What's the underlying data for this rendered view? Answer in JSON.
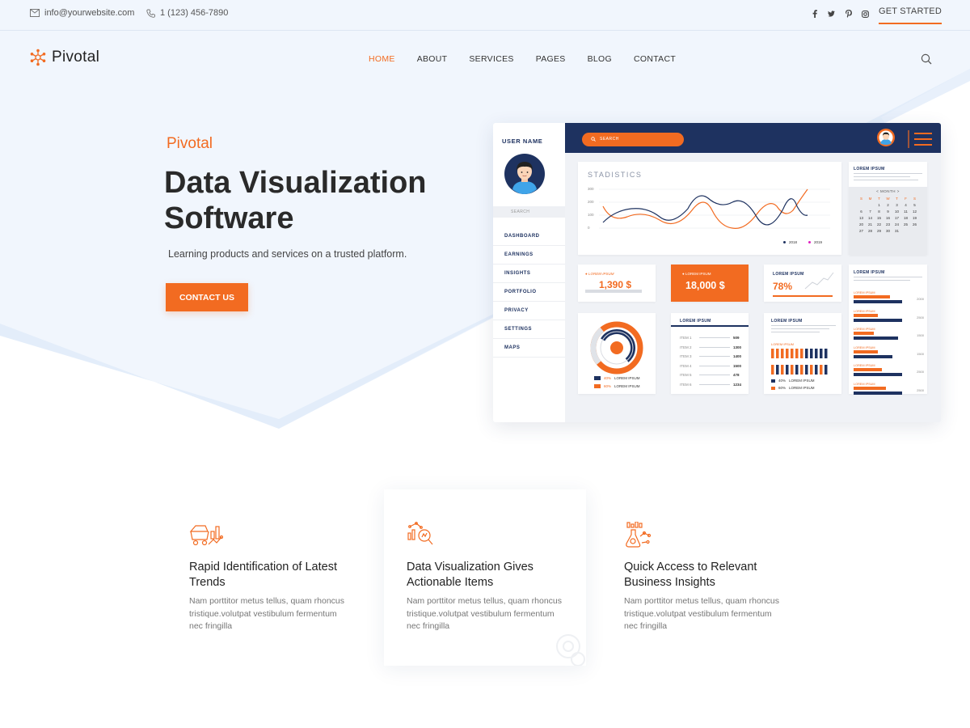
{
  "topbar": {
    "email": "info@yourwebsite.com",
    "phone": "1 (123) 456-7890",
    "social": [
      "facebook-icon",
      "twitter-icon",
      "pinterest-icon",
      "instagram-icon"
    ],
    "cta_label": "GET STARTED"
  },
  "brand": {
    "name": "Pivotal",
    "accent": "#f26b21",
    "navy": "#1e3260"
  },
  "nav": {
    "items": [
      {
        "label": "HOME",
        "active": true
      },
      {
        "label": "ABOUT"
      },
      {
        "label": "SERVICES"
      },
      {
        "label": "PAGES"
      },
      {
        "label": "BLOG"
      },
      {
        "label": "CONTACT"
      }
    ]
  },
  "hero": {
    "eyebrow": "Pivotal",
    "headline_line1": "Data Visualization",
    "headline_line2": "Software",
    "subline": "Learning products and services on a trusted platform.",
    "cta_label": "CONTACT US"
  },
  "dashboard": {
    "user_label": "USER NAME",
    "side_search": "SEARCH",
    "menu": [
      "DASHBOARD",
      "EARNINGS",
      "INSIGHTS",
      "PORTFOLIO",
      "PRIVACY",
      "SETTINGS",
      "MAPS"
    ],
    "top_search": "SEARCH",
    "stats_title": "STADISTICS",
    "stats_legend": [
      "2018",
      "2019"
    ],
    "stats_yticks": [
      "300",
      "200",
      "100",
      "0"
    ],
    "card_label": "LOREM IPSUM",
    "month_label": "MONTH",
    "weekdays": [
      "S",
      "M",
      "T",
      "W",
      "T",
      "F",
      "S"
    ],
    "calendar_days": [
      "1",
      "2",
      "3",
      "4",
      "5",
      "6",
      "7",
      "8",
      "9",
      "10",
      "11",
      "12",
      "13",
      "14",
      "15",
      "16",
      "17",
      "18",
      "19",
      "20",
      "21",
      "22",
      "23",
      "24",
      "25",
      "26",
      "27",
      "28",
      "29",
      "30",
      "31"
    ],
    "kpi1": "1,390 $",
    "kpi2": "18,000 $",
    "kpi3": "78%",
    "donut_legend": [
      {
        "pct": "40%",
        "label": "LOREM IPSUM"
      },
      {
        "pct": "60%",
        "label": "LOREM IPSUM"
      }
    ],
    "item_list": [
      {
        "label": "ITEM 1",
        "value": "509"
      },
      {
        "label": "ITEM 2",
        "value": "1300"
      },
      {
        "label": "ITEM 3",
        "value": "1400"
      },
      {
        "label": "ITEM 4",
        "value": "1500"
      },
      {
        "label": "ITEM 5",
        "value": "478"
      },
      {
        "label": "ITEM 6",
        "value": "1234"
      }
    ],
    "bar_legend": [
      {
        "pct": "40%",
        "label": "LOREM IPSUM"
      },
      {
        "pct": "60%",
        "label": "LOREM IPSUM"
      }
    ],
    "hbar_values": [
      "2000",
      "2500",
      "1500",
      "1500",
      "2500",
      "2500"
    ],
    "hbar_label": "LOREM IPSUM"
  },
  "features": [
    {
      "icon": "cart-chart-icon",
      "title": "Rapid Identification of Latest Trends",
      "text": "Nam porttitor metus tellus, quam rhoncus tristique.volutpat vestibulum fermentum nec fringilla"
    },
    {
      "icon": "analytics-search-icon",
      "title": "Data Visualization Gives Actionable Items",
      "text": "Nam porttitor metus tellus, quam rhoncus tristique.volutpat vestibulum fermentum nec fringilla"
    },
    {
      "icon": "science-insights-icon",
      "title": "Quick Access to Relevant Business Insights",
      "text": "Nam porttitor metus tellus, quam rhoncus tristique.volutpat vestibulum fermentum nec fringilla"
    }
  ]
}
